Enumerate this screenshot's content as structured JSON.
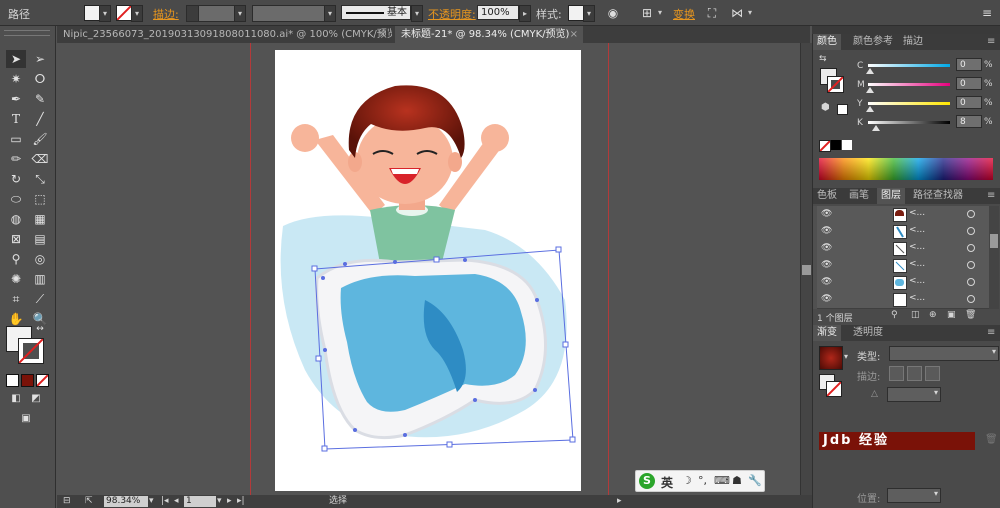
{
  "control_bar": {
    "object_label": "路径",
    "stroke_label": "描边",
    "stroke_style": "基本",
    "opacity_label": "不透明度",
    "opacity_value": "100%",
    "style_label": "样式",
    "transform_label": "变换"
  },
  "tabs": [
    {
      "label": "Nipic_23566073_20190313091808011080.ai* @ 100% (CMYK/预览)",
      "close": "×"
    },
    {
      "label": "未标题-21* @ 98.34% (CMYK/预览)",
      "close": "×"
    }
  ],
  "color_panel": {
    "tabs": [
      "颜色",
      "颜色参考",
      "描边"
    ],
    "channels": [
      {
        "label": "C",
        "value": "0"
      },
      {
        "label": "M",
        "value": "0"
      },
      {
        "label": "Y",
        "value": "0"
      },
      {
        "label": "K",
        "value": "8"
      }
    ]
  },
  "layers_panel": {
    "tabs": [
      "色板",
      "画笔",
      "图层",
      "路径查找器"
    ],
    "rows": [
      {
        "name": "<...",
        "icon": "layer-thumb-hair"
      },
      {
        "name": "<...",
        "icon": "layer-thumb-arm"
      },
      {
        "name": "<...",
        "icon": "layer-thumb-line"
      },
      {
        "name": "<...",
        "icon": "layer-thumb-line"
      },
      {
        "name": "<...",
        "icon": "layer-thumb-blue"
      },
      {
        "name": "<...",
        "icon": "layer-thumb-white"
      }
    ],
    "footer": "1 个图层"
  },
  "gradient_panel": {
    "tabs": [
      "渐变",
      "透明度"
    ],
    "type_label": "类型",
    "stroke_label": "描边",
    "position_label": "位置"
  },
  "status_bar": {
    "zoom": "98.34%",
    "page": "1",
    "tool": "选择"
  },
  "ime": {
    "logo": "S",
    "lang": "英"
  },
  "watermark": "Jdb 经验"
}
